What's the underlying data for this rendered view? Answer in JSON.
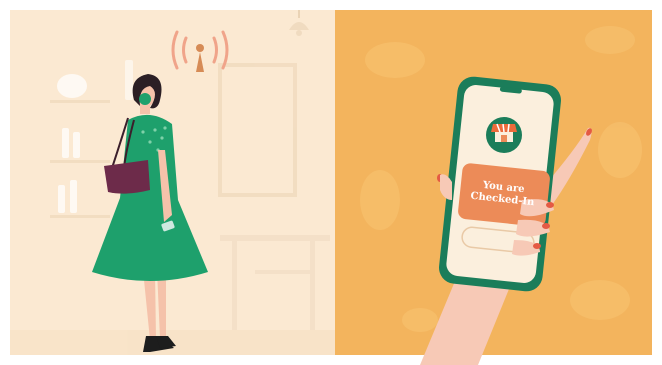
{
  "checkin_card": {
    "line1": "You are",
    "line2": "Checked-In"
  },
  "colors": {
    "left_background": "#fbe9d2",
    "right_background": "#f3b45d",
    "dress": "#1ea06c",
    "bag": "#6d2b4a",
    "phone_frame": "#1b7d5a",
    "card": "#ec8b58",
    "skin": "#f7c9b6"
  },
  "icons": [
    "wifi-signal-icon",
    "store-awning-icon",
    "ceiling-lamp-icon"
  ]
}
